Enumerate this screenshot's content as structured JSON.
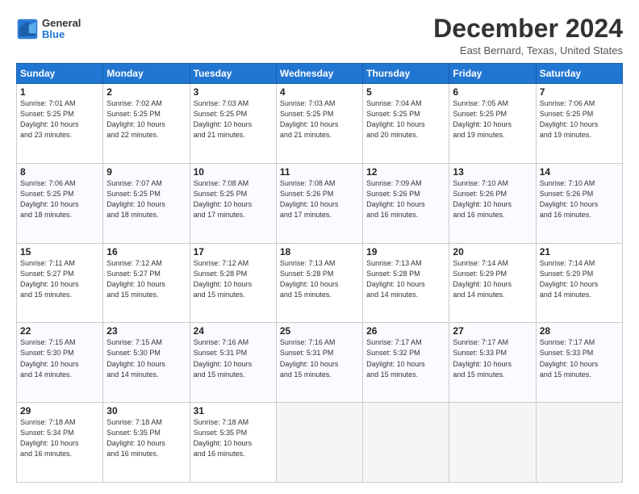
{
  "logo": {
    "line1": "General",
    "line2": "Blue"
  },
  "title": "December 2024",
  "location": "East Bernard, Texas, United States",
  "days_header": [
    "Sunday",
    "Monday",
    "Tuesday",
    "Wednesday",
    "Thursday",
    "Friday",
    "Saturday"
  ],
  "weeks": [
    [
      {
        "day": 1,
        "info": "Sunrise: 7:01 AM\nSunset: 5:25 PM\nDaylight: 10 hours\nand 23 minutes."
      },
      {
        "day": 2,
        "info": "Sunrise: 7:02 AM\nSunset: 5:25 PM\nDaylight: 10 hours\nand 22 minutes."
      },
      {
        "day": 3,
        "info": "Sunrise: 7:03 AM\nSunset: 5:25 PM\nDaylight: 10 hours\nand 21 minutes."
      },
      {
        "day": 4,
        "info": "Sunrise: 7:03 AM\nSunset: 5:25 PM\nDaylight: 10 hours\nand 21 minutes."
      },
      {
        "day": 5,
        "info": "Sunrise: 7:04 AM\nSunset: 5:25 PM\nDaylight: 10 hours\nand 20 minutes."
      },
      {
        "day": 6,
        "info": "Sunrise: 7:05 AM\nSunset: 5:25 PM\nDaylight: 10 hours\nand 19 minutes."
      },
      {
        "day": 7,
        "info": "Sunrise: 7:06 AM\nSunset: 5:25 PM\nDaylight: 10 hours\nand 19 minutes."
      }
    ],
    [
      {
        "day": 8,
        "info": "Sunrise: 7:06 AM\nSunset: 5:25 PM\nDaylight: 10 hours\nand 18 minutes."
      },
      {
        "day": 9,
        "info": "Sunrise: 7:07 AM\nSunset: 5:25 PM\nDaylight: 10 hours\nand 18 minutes."
      },
      {
        "day": 10,
        "info": "Sunrise: 7:08 AM\nSunset: 5:25 PM\nDaylight: 10 hours\nand 17 minutes."
      },
      {
        "day": 11,
        "info": "Sunrise: 7:08 AM\nSunset: 5:26 PM\nDaylight: 10 hours\nand 17 minutes."
      },
      {
        "day": 12,
        "info": "Sunrise: 7:09 AM\nSunset: 5:26 PM\nDaylight: 10 hours\nand 16 minutes."
      },
      {
        "day": 13,
        "info": "Sunrise: 7:10 AM\nSunset: 5:26 PM\nDaylight: 10 hours\nand 16 minutes."
      },
      {
        "day": 14,
        "info": "Sunrise: 7:10 AM\nSunset: 5:26 PM\nDaylight: 10 hours\nand 16 minutes."
      }
    ],
    [
      {
        "day": 15,
        "info": "Sunrise: 7:11 AM\nSunset: 5:27 PM\nDaylight: 10 hours\nand 15 minutes."
      },
      {
        "day": 16,
        "info": "Sunrise: 7:12 AM\nSunset: 5:27 PM\nDaylight: 10 hours\nand 15 minutes."
      },
      {
        "day": 17,
        "info": "Sunrise: 7:12 AM\nSunset: 5:28 PM\nDaylight: 10 hours\nand 15 minutes."
      },
      {
        "day": 18,
        "info": "Sunrise: 7:13 AM\nSunset: 5:28 PM\nDaylight: 10 hours\nand 15 minutes."
      },
      {
        "day": 19,
        "info": "Sunrise: 7:13 AM\nSunset: 5:28 PM\nDaylight: 10 hours\nand 14 minutes."
      },
      {
        "day": 20,
        "info": "Sunrise: 7:14 AM\nSunset: 5:29 PM\nDaylight: 10 hours\nand 14 minutes."
      },
      {
        "day": 21,
        "info": "Sunrise: 7:14 AM\nSunset: 5:29 PM\nDaylight: 10 hours\nand 14 minutes."
      }
    ],
    [
      {
        "day": 22,
        "info": "Sunrise: 7:15 AM\nSunset: 5:30 PM\nDaylight: 10 hours\nand 14 minutes."
      },
      {
        "day": 23,
        "info": "Sunrise: 7:15 AM\nSunset: 5:30 PM\nDaylight: 10 hours\nand 14 minutes."
      },
      {
        "day": 24,
        "info": "Sunrise: 7:16 AM\nSunset: 5:31 PM\nDaylight: 10 hours\nand 15 minutes."
      },
      {
        "day": 25,
        "info": "Sunrise: 7:16 AM\nSunset: 5:31 PM\nDaylight: 10 hours\nand 15 minutes."
      },
      {
        "day": 26,
        "info": "Sunrise: 7:17 AM\nSunset: 5:32 PM\nDaylight: 10 hours\nand 15 minutes."
      },
      {
        "day": 27,
        "info": "Sunrise: 7:17 AM\nSunset: 5:33 PM\nDaylight: 10 hours\nand 15 minutes."
      },
      {
        "day": 28,
        "info": "Sunrise: 7:17 AM\nSunset: 5:33 PM\nDaylight: 10 hours\nand 15 minutes."
      }
    ],
    [
      {
        "day": 29,
        "info": "Sunrise: 7:18 AM\nSunset: 5:34 PM\nDaylight: 10 hours\nand 16 minutes."
      },
      {
        "day": 30,
        "info": "Sunrise: 7:18 AM\nSunset: 5:35 PM\nDaylight: 10 hours\nand 16 minutes."
      },
      {
        "day": 31,
        "info": "Sunrise: 7:18 AM\nSunset: 5:35 PM\nDaylight: 10 hours\nand 16 minutes."
      },
      null,
      null,
      null,
      null
    ]
  ]
}
